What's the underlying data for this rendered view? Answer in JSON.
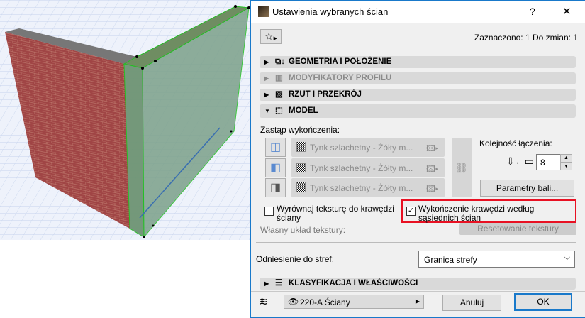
{
  "dialog": {
    "title": "Ustawienia wybranych ścian",
    "help_label": "?",
    "close_label": "✕",
    "status": "Zaznaczono: 1 Do zmian: 1",
    "sections": [
      {
        "label": "GEOMETRIA I POŁOŻENIE",
        "expanded": false,
        "enabled": true
      },
      {
        "label": "MODYFIKATORY PROFILU",
        "expanded": false,
        "enabled": false
      },
      {
        "label": "RZUT I PRZEKRÓJ",
        "expanded": false,
        "enabled": true
      },
      {
        "label": "MODEL",
        "expanded": true,
        "enabled": true
      }
    ],
    "model": {
      "override_label": "Zastąp wykończenia:",
      "surfaces": [
        {
          "value": "Tynk szlachetny - Żółty m..."
        },
        {
          "value": "Tynk szlachetny - Żółty m..."
        },
        {
          "value": "Tynk szlachetny - Żółty m..."
        }
      ],
      "join_order_label": "Kolejność łączenia:",
      "join_order_value": "8",
      "params_button": "Parametry bali...",
      "align_texture_label": "Wyrównaj teksturę do krawędzi ściany",
      "align_texture_checked": false,
      "edge_finish_label": "Wykończenie krawędzi według sąsiednich ścian",
      "edge_finish_checked": true,
      "custom_texture_label": "Własny układ tekstury:",
      "reset_texture_button": "Resetowanie tekstury",
      "zone_label": "Odniesienie do stref:",
      "zone_value": "Granica strefy"
    },
    "classification_section": "KLASYFIKACJA I WŁAŚCIWOŚCI",
    "layer_value": "220-A Ściany",
    "cancel_button": "Anuluj",
    "ok_button": "OK"
  },
  "colors": {
    "accent": "#1979ca",
    "highlight": "#e81123",
    "selection": "#22c022"
  }
}
